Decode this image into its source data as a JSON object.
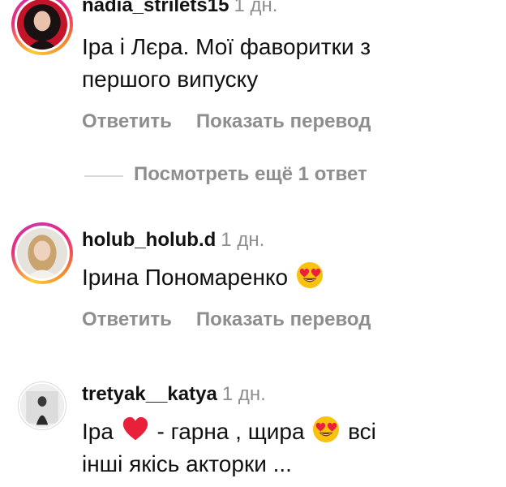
{
  "comments": [
    {
      "username": "nadia_strilets15",
      "time": "1 дн.",
      "text_1": "Іра і Лєра. Мої фаворитки з",
      "text_2": "першого випуску",
      "reply_label": "Ответить",
      "translate_label": "Показать перевод"
    },
    {
      "username": "holub_holub.d",
      "time": "1 дн.",
      "text_1": "Ірина Пономаренко",
      "emoji": "heart-eyes-emoji",
      "reply_label": "Ответить",
      "translate_label": "Показать перевод"
    },
    {
      "username": "tretyak__katya",
      "time": "1 дн.",
      "text_a": "Іра",
      "text_b": " - гарна , щира",
      "text_c": " всі",
      "text_2": "інші якісь акторки ..."
    }
  ],
  "view_replies_label": "Посмотреть ещё 1 ответ",
  "icons": [
    "heart-eyes-emoji",
    "red-heart-emoji"
  ],
  "colors": {
    "text": "#111111",
    "muted": "#8e8e8e",
    "heart": "#e8203a",
    "emoji_face": "#f9c20f"
  }
}
